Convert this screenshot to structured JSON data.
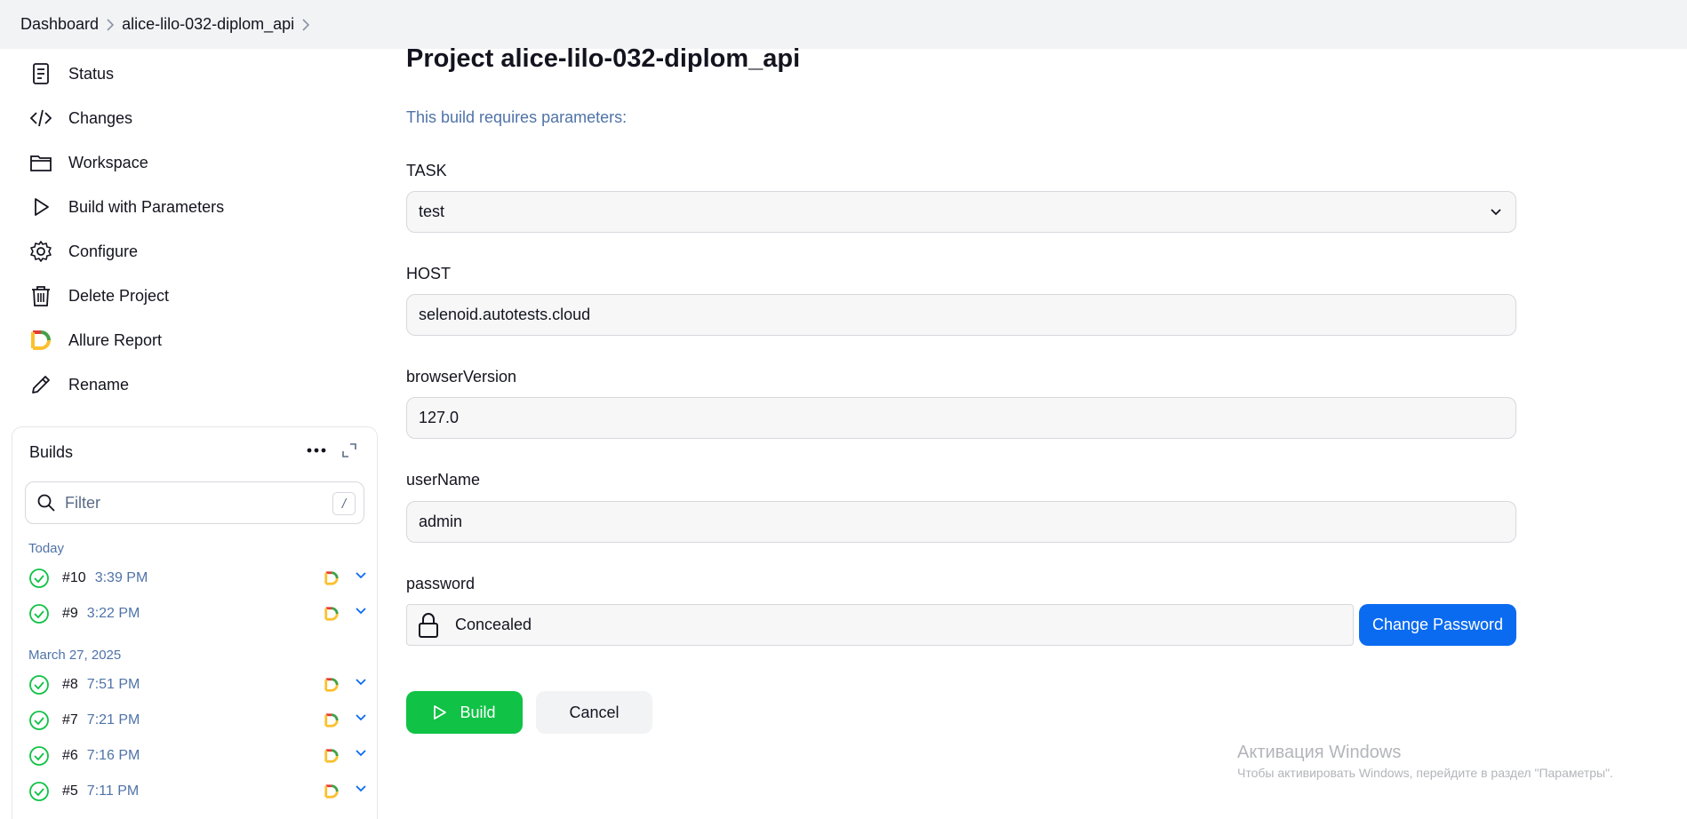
{
  "breadcrumb": {
    "items": [
      "Dashboard",
      "alice-lilo-032-diplom_api"
    ]
  },
  "sidebar": {
    "tasks": [
      {
        "label": "Status",
        "icon": "document-icon"
      },
      {
        "label": "Changes",
        "icon": "code-icon"
      },
      {
        "label": "Workspace",
        "icon": "folder-icon"
      },
      {
        "label": "Build with Parameters",
        "icon": "play-icon"
      },
      {
        "label": "Configure",
        "icon": "gear-icon"
      },
      {
        "label": "Delete Project",
        "icon": "trash-icon"
      },
      {
        "label": "Allure Report",
        "icon": "allure-icon"
      },
      {
        "label": "Rename",
        "icon": "pencil-icon"
      }
    ]
  },
  "builds": {
    "title": "Builds",
    "filter_placeholder": "Filter",
    "filter_shortcut": "/",
    "groups": [
      {
        "label": "Today",
        "rows": [
          {
            "number": "#10",
            "time": "3:39 PM"
          },
          {
            "number": "#9",
            "time": "3:22 PM"
          }
        ]
      },
      {
        "label": "March 27, 2025",
        "rows": [
          {
            "number": "#8",
            "time": "7:51 PM"
          },
          {
            "number": "#7",
            "time": "7:21 PM"
          },
          {
            "number": "#6",
            "time": "7:16 PM"
          },
          {
            "number": "#5",
            "time": "7:11 PM"
          }
        ]
      }
    ]
  },
  "main": {
    "title": "Project alice-lilo-032-diplom_api",
    "subtitle": "This build requires parameters:",
    "params": {
      "task": {
        "label": "TASK",
        "value": "test"
      },
      "host": {
        "label": "HOST",
        "value": "selenoid.autotests.cloud"
      },
      "browser_version": {
        "label": "browserVersion",
        "value": "127.0"
      },
      "user_name": {
        "label": "userName",
        "value": "admin"
      },
      "password": {
        "label": "password",
        "value": "Concealed",
        "change_label": "Change Password"
      }
    },
    "build_label": "Build",
    "cancel_label": "Cancel"
  },
  "watermark": {
    "title": "Активация Windows",
    "subtitle": "Чтобы активировать Windows, перейдите в раздел \"Параметры\"."
  },
  "colors": {
    "accent_blue": "#0b6bf0",
    "success_green": "#10c245",
    "link_blue": "#4f73a8"
  }
}
